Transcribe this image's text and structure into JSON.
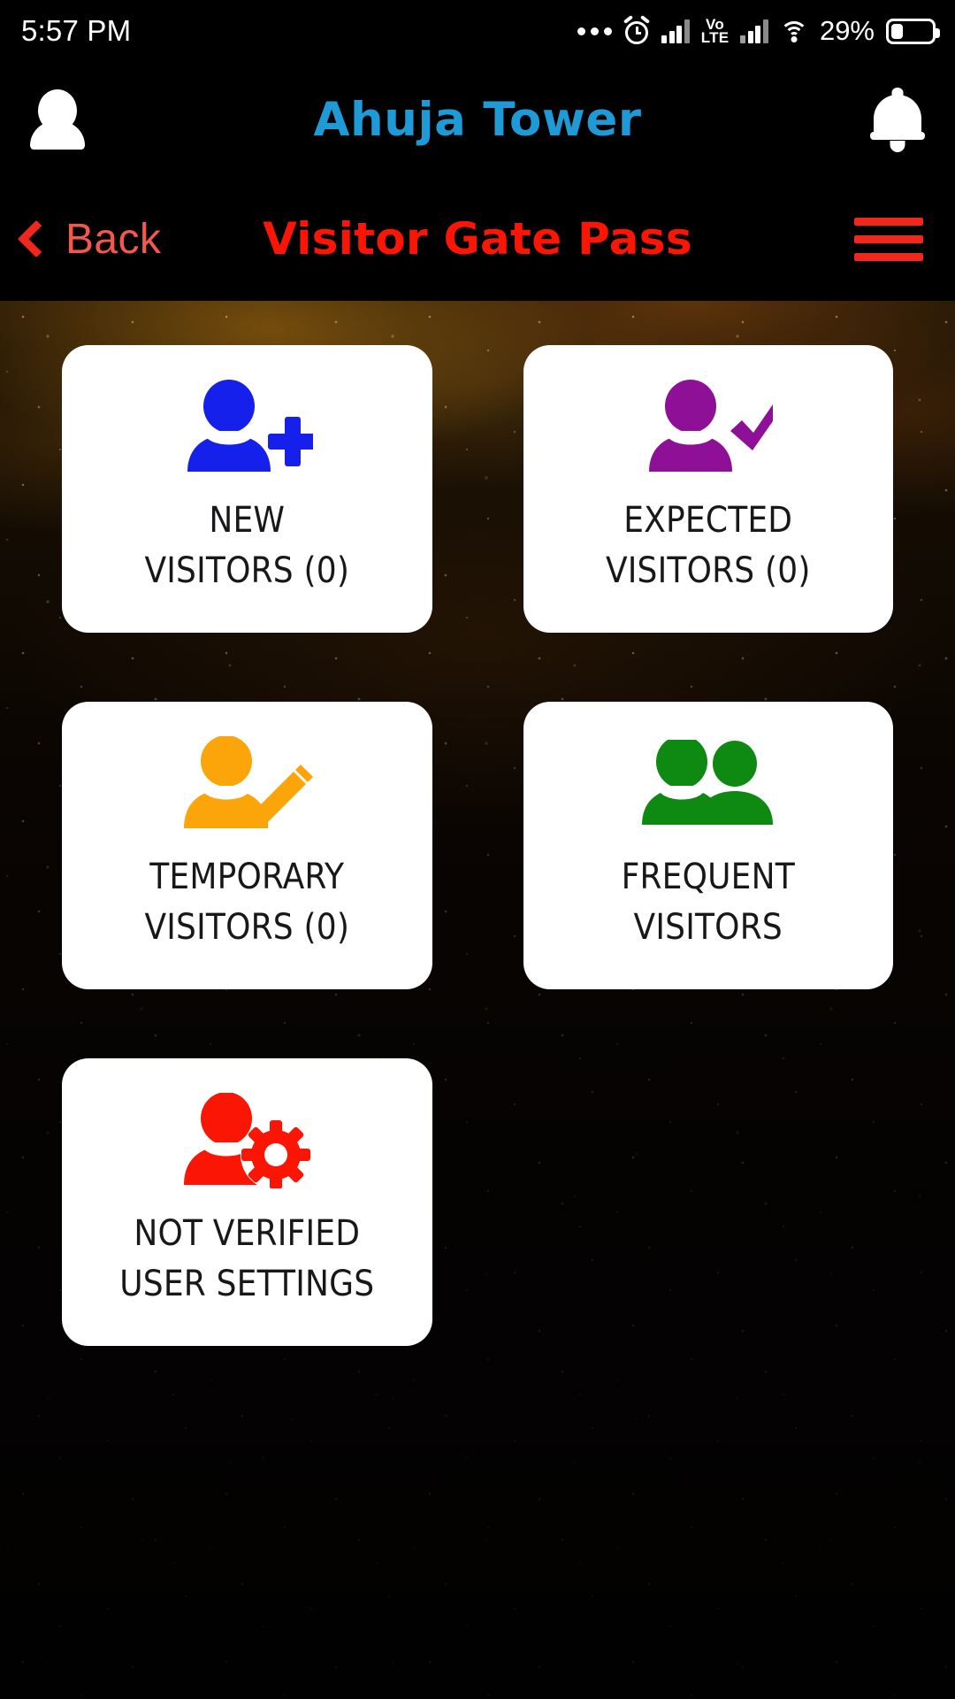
{
  "status_bar": {
    "time": "5:57 PM",
    "battery_percent": "29%",
    "network_label": "LTE",
    "volte_label": "Vo",
    "icons": [
      "more-dots-icon",
      "alarm-icon",
      "signal-icon",
      "volte-icon",
      "signal-icon",
      "wifi-icon",
      "battery-icon"
    ]
  },
  "app_bar": {
    "title": "Ahuja Tower",
    "title_color": "#1e9ad6",
    "profile_icon": "person-icon",
    "notification_icon": "bell-icon"
  },
  "sub_bar": {
    "back_label": "Back",
    "title": "Visitor Gate Pass",
    "title_color": "#fb1505",
    "back_color": "#f2594c",
    "menu_icon": "hamburger-menu-icon"
  },
  "tiles": [
    {
      "id": "new-visitors",
      "line1": "NEW",
      "line2": "VISITORS (0)",
      "icon": "person-add-icon",
      "color": "#1520eb"
    },
    {
      "id": "expected-visitors",
      "line1": "EXPECTED",
      "line2": "VISITORS (0)",
      "icon": "person-check-icon",
      "color": "#8e1096"
    },
    {
      "id": "temporary-visitors",
      "line1": "TEMPORARY",
      "line2": "VISITORS (0)",
      "icon": "person-edit-icon",
      "color": "#fca50b"
    },
    {
      "id": "frequent-visitors",
      "line1": "FREQUENT",
      "line2": "VISITORS",
      "icon": "people-group-icon",
      "color": "#0e8a12"
    },
    {
      "id": "not-verified-user-settings",
      "line1": "NOT VERIFIED",
      "line2": "USER SETTINGS",
      "icon": "person-gear-icon",
      "color": "#fb1505"
    }
  ]
}
